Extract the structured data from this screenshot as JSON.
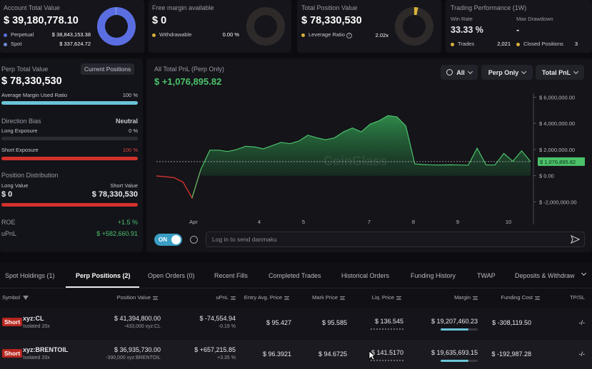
{
  "account": {
    "title": "Account Total Value",
    "value": "$ 39,180,778.10",
    "perpetual_label": "Perpetual",
    "perpetual_value": "$ 38,843,153.38",
    "spot_label": "Spot",
    "spot_value": "$ 337,624.72"
  },
  "margin": {
    "title": "Free margin available",
    "value": "$ 0",
    "withdrawable_label": "Withdrawable",
    "withdrawable_value": "0.00 %"
  },
  "position": {
    "title": "Total Position Value",
    "value": "$ 78,330,530",
    "leverage_label": "Leverage Ratio",
    "leverage_value": "2.02x"
  },
  "performance": {
    "title": "Trading Performance (1W)",
    "win_rate_label": "Win Rate",
    "win_rate_value": "33.33 %",
    "drawdown_label": "Max Drawdown",
    "drawdown_value": "-",
    "trades_label": "Trades",
    "trades_value": "2,021",
    "closed_label": "Closed Positions",
    "closed_value": "3"
  },
  "perp": {
    "title": "Perp Total Value",
    "current_positions_button": "Current Positions",
    "value": "$ 78,330,530",
    "avg_margin_label": "Average Margin Used Ratio",
    "avg_margin_value": "100 %",
    "avg_margin_fraction": 1.0,
    "direction_label": "Direction Bias",
    "direction_value": "Neutral",
    "long_label": "Long Exposure",
    "long_value": "0 %",
    "long_fraction": 0,
    "short_label": "Short Exposure",
    "short_value": "100 %",
    "short_fraction": 1.0,
    "distribution_label": "Position Distribution",
    "long_value_label": "Long Value",
    "short_value_label": "Short Value",
    "long_value_amt": "$ 0",
    "short_value_amt": "$ 78,330,530",
    "roe_label": "ROE",
    "roe_value": "+1.5 %",
    "upnl_label": "uPnL",
    "upnl_value": "$ +582,660.91"
  },
  "pnl": {
    "title": "All Total PnL (Perp Only)",
    "value": "$ +1,076,895.82",
    "filter_all": "All",
    "filter_perp": "Perp Only",
    "filter_total": "Total PnL",
    "current_label": "$ 1,076,895.82",
    "watermark": "CoinGlass"
  },
  "chart_data": {
    "type": "area",
    "title": "All Total PnL (Perp Only)",
    "x_ticks": [
      "Apr",
      "4",
      "5",
      "7",
      "8",
      "9",
      "10"
    ],
    "y_ticks": [
      "$ 6,000,000.00",
      "$ 4,000,000.00",
      "$ 2,000,000.00",
      "$ 0.00",
      "$ -2,000,000.00"
    ],
    "ylim": [
      -2200000,
      6300000
    ],
    "y": [
      -20000,
      -80000,
      -150000,
      -500000,
      -1700000,
      500000,
      1950000,
      1950000,
      1850000,
      2000000,
      2250000,
      2200000,
      2050000,
      2300000,
      2550000,
      2450000,
      2650000,
      3100000,
      2900000,
      2750000,
      2900000,
      3350000,
      3650000,
      3350000,
      3950000,
      4200000,
      4600000,
      4500000,
      3800000,
      900000,
      850000,
      820000,
      820000,
      830000,
      820000,
      800000,
      2100000,
      820000,
      820000,
      1700000,
      1100000,
      1900000,
      1076895.82
    ],
    "grid": false,
    "legend": "none",
    "positive_color": "#4cc26a",
    "negative_color": "#d2322b"
  },
  "danmaku": {
    "toggle": "ON",
    "placeholder": "Log in to send danmaku"
  },
  "tabs": [
    "Spot Holdings (1)",
    "Perp Positions (2)",
    "Open Orders (0)",
    "Recent Fills",
    "Completed Trades",
    "Historical Orders",
    "Funding History",
    "TWAP",
    "Deposits & Withdraw"
  ],
  "table": {
    "headers": [
      "Symbol",
      "Position Value",
      "uPnL",
      "Entry Avg. Price",
      "Mark Price",
      "Liq. Price",
      "Margin",
      "Funding Cost",
      "TP/SL"
    ],
    "rows": [
      {
        "side": "Short",
        "symbol": "xyz:CL",
        "mode": "Isolated 20x",
        "position_value": "$ 41,394,800.00",
        "position_size": "-433,000 xyz:CL",
        "upnl": "$ -74,554.94",
        "upnl_pct": "-0.19 %",
        "entry": "$ 95.427",
        "mark": "$ 95.585",
        "liq": "$ 136.545",
        "margin": "$ 19,207,460.23",
        "margin_fraction": 0.75,
        "funding": "$ -308,119.50",
        "tpsl": "-/-"
      },
      {
        "side": "Short",
        "symbol": "xyz:BRENTOIL",
        "mode": "Isolated 20x",
        "position_value": "$ 36,935,730.00",
        "position_size": "-390,000 xyz:BRENTOIL",
        "upnl": "$ +657,215.85",
        "upnl_pct": "+3.35 %",
        "entry": "$ 96.3921",
        "mark": "$ 94.6725",
        "liq": "$ 141.5170",
        "margin": "$ 19,635,693.15",
        "margin_fraction": 0.75,
        "funding": "$ -192,987.28",
        "tpsl": "-/-"
      }
    ]
  },
  "colors": {
    "accent_blue": "#5b6ee1",
    "green": "#4cc26a",
    "red": "#e0473c",
    "gold": "#d6b13a"
  }
}
